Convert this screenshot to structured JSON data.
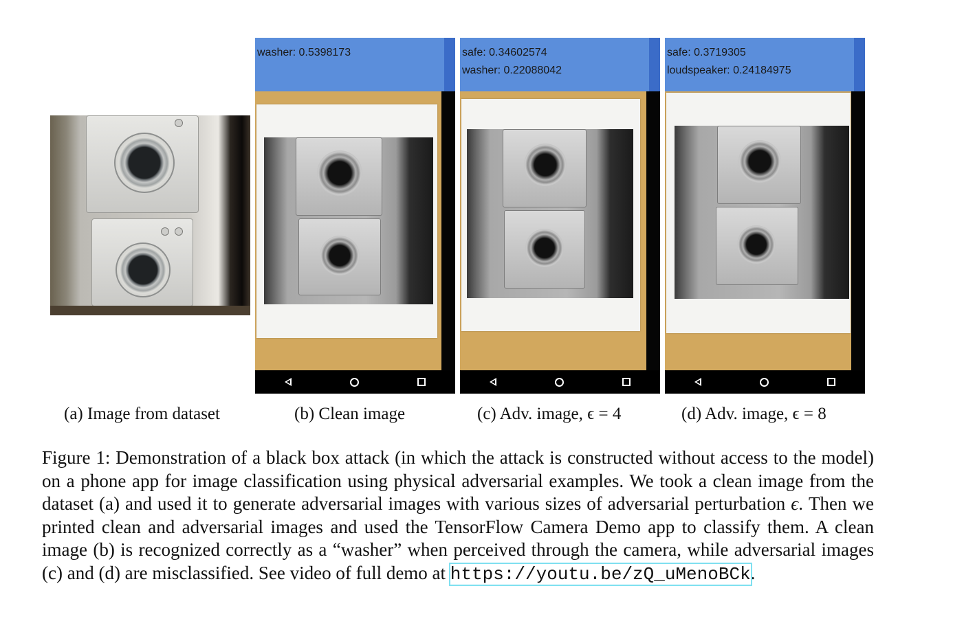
{
  "panels": [
    {
      "id": "a",
      "caption": "(a) Image from dataset"
    },
    {
      "id": "b",
      "caption": "(b) Clean image",
      "labels": [
        "washer: 0.5398173"
      ]
    },
    {
      "id": "c",
      "caption": "(c) Adv. image, ϵ = 4",
      "labels": [
        "safe: 0.34602574",
        "washer: 0.22088042"
      ]
    },
    {
      "id": "d",
      "caption": "(d) Adv. image, ϵ = 8",
      "labels": [
        "safe: 0.3719305",
        "loudspeaker: 0.24184975"
      ]
    }
  ],
  "nav_icons": [
    "back-icon",
    "home-icon",
    "recents-icon"
  ],
  "caption": {
    "part1": "Figure 1: Demonstration of a black box attack (in which the attack is constructed without access to the model) on a phone app for image classification using physical adversarial examples. We took a clean image from the dataset (a) and used it to generate adversarial images with various sizes of adversarial perturbation ",
    "epsilon": "ϵ",
    "part2": ". Then we printed clean and adversarial images and used the TensorFlow Camera Demo app to classify them. A clean image (b) is recognized correctly as a “washer” when perceived through the camera, while adversarial images (c) and (d) are misclassified. See video of full demo at ",
    "url": "https://youtu.be/zQ_uMenoBCk",
    "part3": "."
  },
  "colors": {
    "status_bar": "#5b8edb",
    "status_bar_edge": "#3b6cc8",
    "url_box": "#7fe0f0"
  }
}
